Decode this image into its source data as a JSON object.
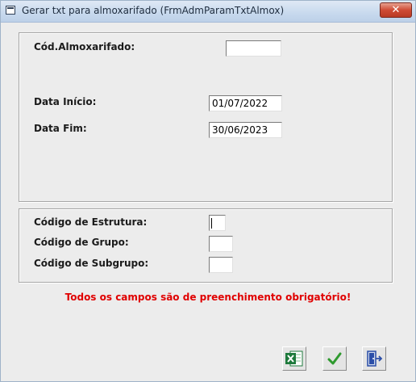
{
  "window": {
    "title": "Gerar txt para almoxarifado (FrmAdmParamTxtAlmox)",
    "close_label": "✕"
  },
  "form": {
    "almox_label": "Cód.Almoxarifado:",
    "almox_value": "",
    "data_inicio_label": "Data Início:",
    "data_inicio_value": "01/07/2022",
    "data_fim_label": "Data Fim:",
    "data_fim_value": "30/06/2023",
    "estrutura_label": "Código de Estrutura:",
    "estrutura_value": "",
    "grupo_label": "Código de Grupo:",
    "grupo_value": "",
    "subgrupo_label": "Código de Subgrupo:",
    "subgrupo_value": ""
  },
  "warning": "Todos os campos são de preenchimento obrigatório!",
  "toolbar": {
    "buttons": [
      {
        "icon": "excel-icon",
        "color": "#1e7a3c"
      },
      {
        "icon": "checkmark-icon",
        "color": "#2e9a2e"
      },
      {
        "icon": "exit-door-icon",
        "color": "#2b4ea8"
      }
    ]
  },
  "colors": {
    "warning": "#e00000",
    "close_button": "#cf4b35"
  }
}
